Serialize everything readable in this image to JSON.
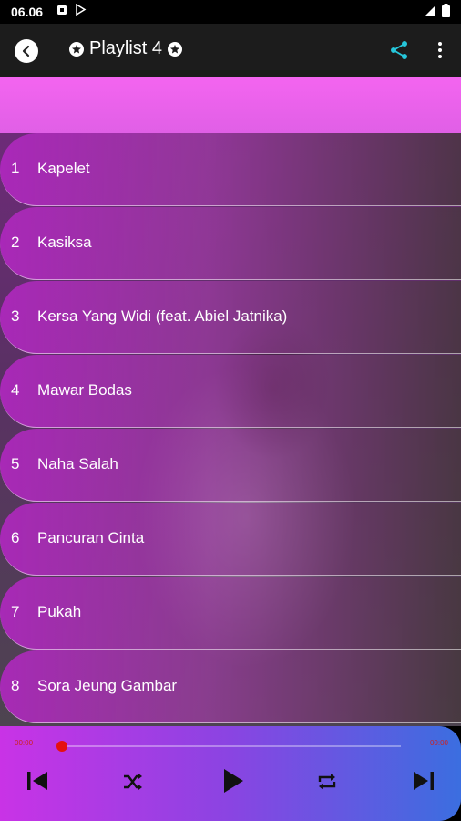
{
  "status_bar": {
    "time": "06.06"
  },
  "header": {
    "title": "Playlist 4"
  },
  "tracks": [
    {
      "num": "1",
      "title": "Kapelet"
    },
    {
      "num": "2",
      "title": "Kasiksa"
    },
    {
      "num": "3",
      "title": "Kersa Yang Widi (feat. Abiel Jatnika)"
    },
    {
      "num": "4",
      "title": "Mawar Bodas"
    },
    {
      "num": "5",
      "title": "Naha Salah"
    },
    {
      "num": "6",
      "title": "Pancuran Cinta"
    },
    {
      "num": "7",
      "title": "Pukah"
    },
    {
      "num": "8",
      "title": "Sora Jeung Gambar"
    }
  ],
  "player": {
    "current_time": "00:00",
    "total_time": "00:00",
    "progress": 0.0
  },
  "icons": {
    "back": "back-icon",
    "share": "share-icon",
    "more": "more-vert-icon",
    "prev": "skip-previous-icon",
    "shuffle": "shuffle-icon",
    "play": "play-icon",
    "repeat": "repeat-icon",
    "next": "skip-next-icon"
  },
  "colors": {
    "accent_share": "#26c6da",
    "seek_thumb": "#e51010",
    "app_bar": "#1c1c1c"
  }
}
